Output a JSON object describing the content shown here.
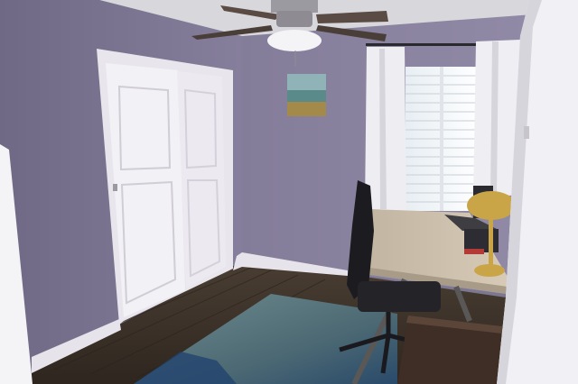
{
  "scene": {
    "description_colors": {
      "wall": "#8a83a0",
      "wall_shadow": "#6f6985",
      "ceiling": "#d9d8dc",
      "trim": "#e9e7ee",
      "door": "#f1f0f4",
      "floor": "#3b3129",
      "rug": "#4f6c74",
      "curtain": "#ecebef",
      "desk_top": "#cfc2ae",
      "desk_leg": "#5b5757",
      "chair": "#1f1f23",
      "lamp": "#c9a548"
    }
  }
}
